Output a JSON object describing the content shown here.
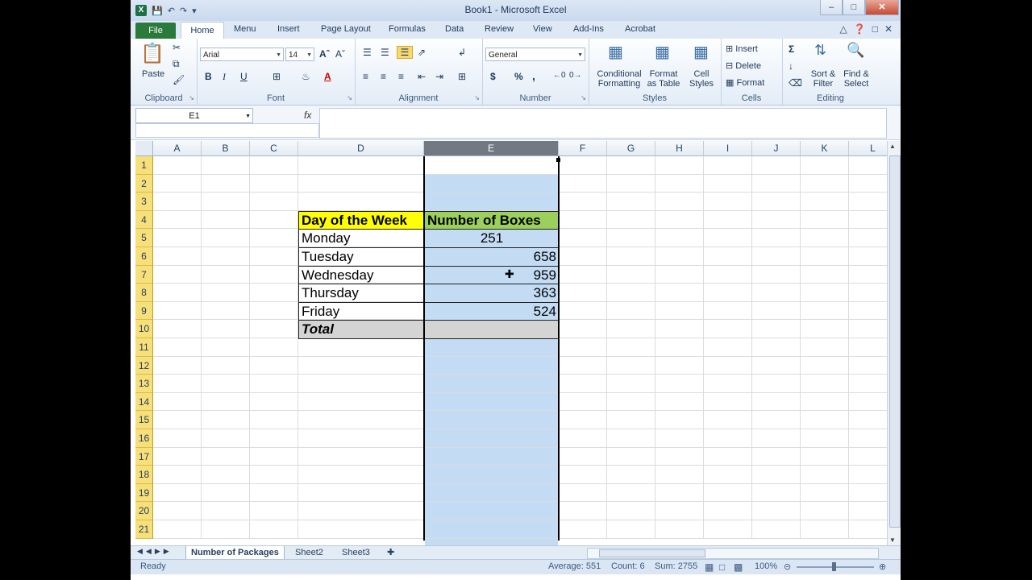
{
  "window": {
    "title": "Book1  -  Microsoft Excel",
    "app_icon": "excel-logo-icon"
  },
  "ribbon_tabs": [
    "File",
    "Home",
    "Menu",
    "Insert",
    "Page Layout",
    "Formulas",
    "Data",
    "Review",
    "View",
    "Add-Ins",
    "Acrobat"
  ],
  "ribbon": {
    "clipboard": {
      "group_label": "Clipboard",
      "paste_label": "Paste"
    },
    "font": {
      "group_label": "Font",
      "font_name": "Arial",
      "font_size": "14",
      "bold": "B",
      "italic": "I",
      "underline": "U",
      "font_color_glyph": "A"
    },
    "alignment": {
      "group_label": "Alignment"
    },
    "number": {
      "group_label": "Number",
      "format": "General",
      "currency": "$",
      "percent": "%",
      "comma": ","
    },
    "styles": {
      "group_label": "Styles",
      "conditional_1": "Conditional",
      "conditional_2": "Formatting",
      "format_table_1": "Format",
      "format_table_2": "as Table",
      "cell_styles_1": "Cell",
      "cell_styles_2": "Styles"
    },
    "cells": {
      "group_label": "Cells",
      "insert": "Insert",
      "delete": "Delete",
      "format": "Format"
    },
    "editing": {
      "group_label": "Editing",
      "sort_1": "Sort &",
      "sort_2": "Filter",
      "find_1": "Find &",
      "find_2": "Select"
    }
  },
  "formula_bar": {
    "name_box": "E1",
    "fx": "fx",
    "value": ""
  },
  "columns": [
    "A",
    "B",
    "C",
    "D",
    "E",
    "F",
    "G",
    "H",
    "I",
    "J",
    "K",
    "L"
  ],
  "selected_column": "E",
  "rows": [
    "1",
    "2",
    "3",
    "4",
    "5",
    "6",
    "7",
    "8",
    "9",
    "10",
    "11",
    "12",
    "13",
    "14",
    "15",
    "16",
    "17",
    "18",
    "19",
    "20",
    "21"
  ],
  "table": {
    "header_day": "Day of the Week",
    "header_boxes": "Number of Boxes",
    "days": [
      "Monday",
      "Tuesday",
      "Wednesday",
      "Thursday",
      "Friday"
    ],
    "boxes": [
      "251",
      "658",
      "959",
      "363",
      "524"
    ],
    "total_label": "Total",
    "total_value": ""
  },
  "sheets": [
    "Number of Packages",
    "Sheet2",
    "Sheet3"
  ],
  "active_sheet": "Number of Packages",
  "status": {
    "ready": "Ready",
    "average": "Average: 551",
    "count": "Count: 6",
    "sum": "Sum: 2755",
    "zoom": "100%"
  },
  "colors": {
    "header_yellow": "#ffff00",
    "header_green": "#9bd05c",
    "selection_blue": "#c3dcf4",
    "row_header_yellow": "#f7e07a",
    "total_gray": "#d4d4d4"
  }
}
